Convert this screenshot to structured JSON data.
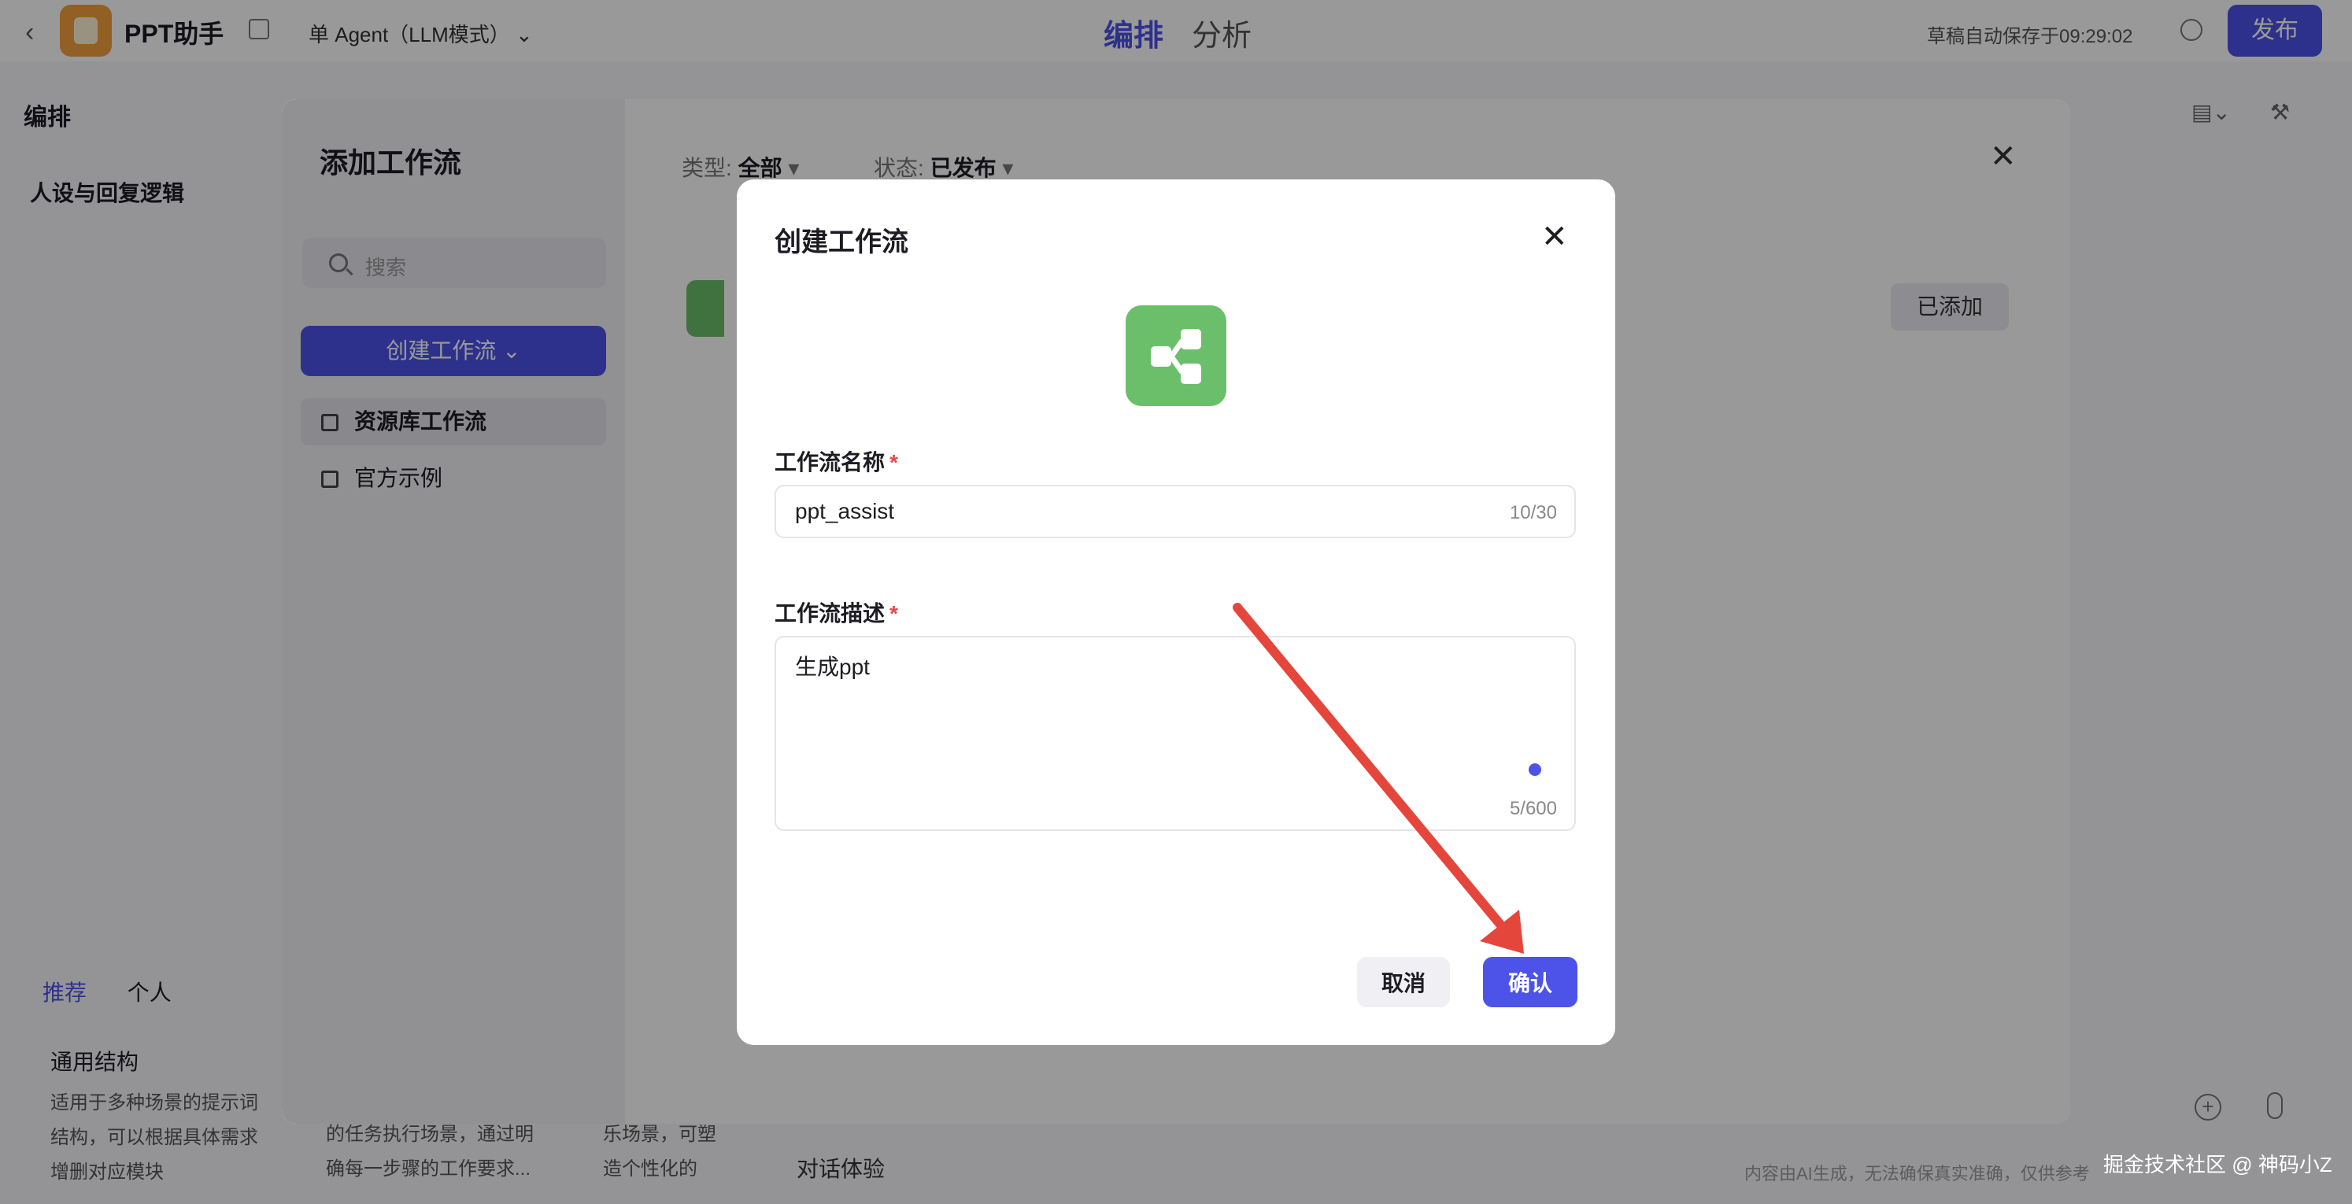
{
  "header": {
    "app_name": "PPT助手",
    "mode": "单 Agent（LLM模式）",
    "tabs": [
      "编排",
      "分析"
    ],
    "autosave": "草稿自动保存于09:29:02",
    "publish_label": "发布"
  },
  "left_panel": {
    "heading": "编排",
    "persona_label": "人设与回复逻辑",
    "template_tabs": [
      "推荐",
      "个人"
    ],
    "template_title": "通用结构",
    "template_desc": "适用于多种场景的提示词结构，可以根据具体需求增删对应模块",
    "template2_desc": "的任务执行场景，通过明确每一步骤的工作要求...",
    "template3_desc": "乐场景，可塑造个性化的"
  },
  "chat": {
    "title": "对话体验",
    "footer_note": "内容由AI生成，无法确保真实准确，仅供参考"
  },
  "add_modal": {
    "title": "添加工作流",
    "search_placeholder": "搜索",
    "create_label": "创建工作流",
    "side_items": [
      "资源库工作流",
      "官方示例"
    ],
    "filter_type_label": "类型:",
    "filter_type_value": "全部",
    "filter_status_label": "状态:",
    "filter_status_value": "已发布",
    "added_label": "已添加"
  },
  "dialog": {
    "title": "创建工作流",
    "name_label": "工作流名称",
    "name_value": "ppt_assist",
    "name_count": "10/30",
    "desc_label": "工作流描述",
    "desc_value": "生成ppt",
    "desc_count": "5/600",
    "cancel_label": "取消",
    "confirm_label": "确认",
    "icon_color": "#6cbf6a",
    "accent_color": "#4d53e8"
  },
  "annotation": {
    "arrow_color": "#e5463b"
  },
  "watermark": "掘金技术社区 @ 神码小Z"
}
